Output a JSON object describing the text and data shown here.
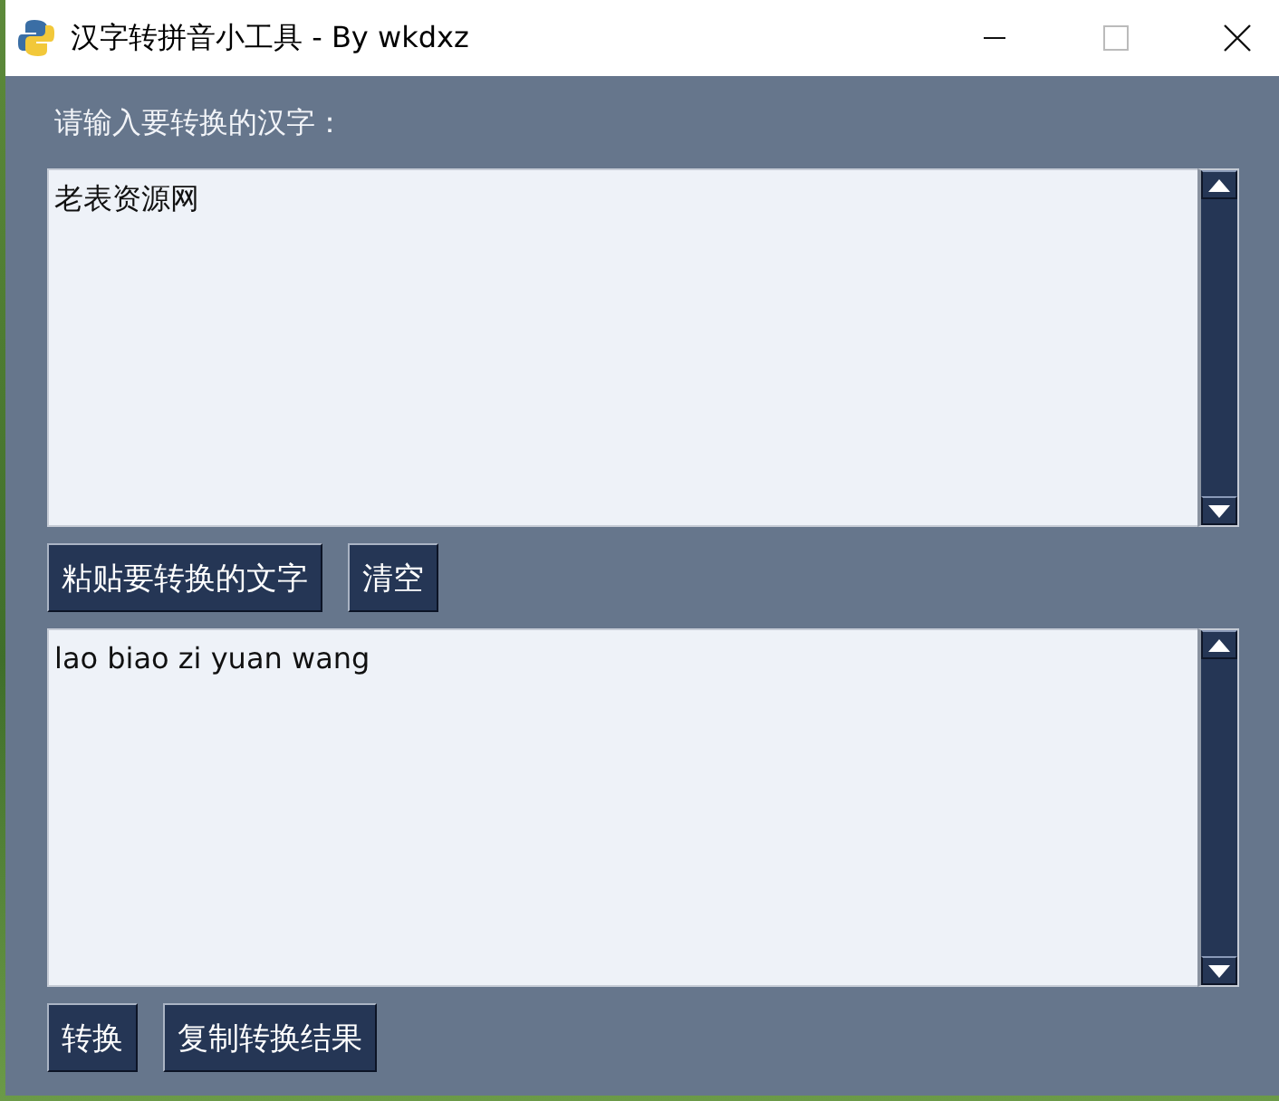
{
  "window": {
    "title": "汉字转拼音小工具 - By wkdxz"
  },
  "input_label": "请输入要转换的汉字：",
  "input_text": "老表资源网",
  "input_buttons": [
    "粘贴要转换的文字",
    "清空"
  ],
  "output_text": "lao biao zi yuan wang",
  "output_buttons": [
    "转换",
    "复制转换结果"
  ]
}
